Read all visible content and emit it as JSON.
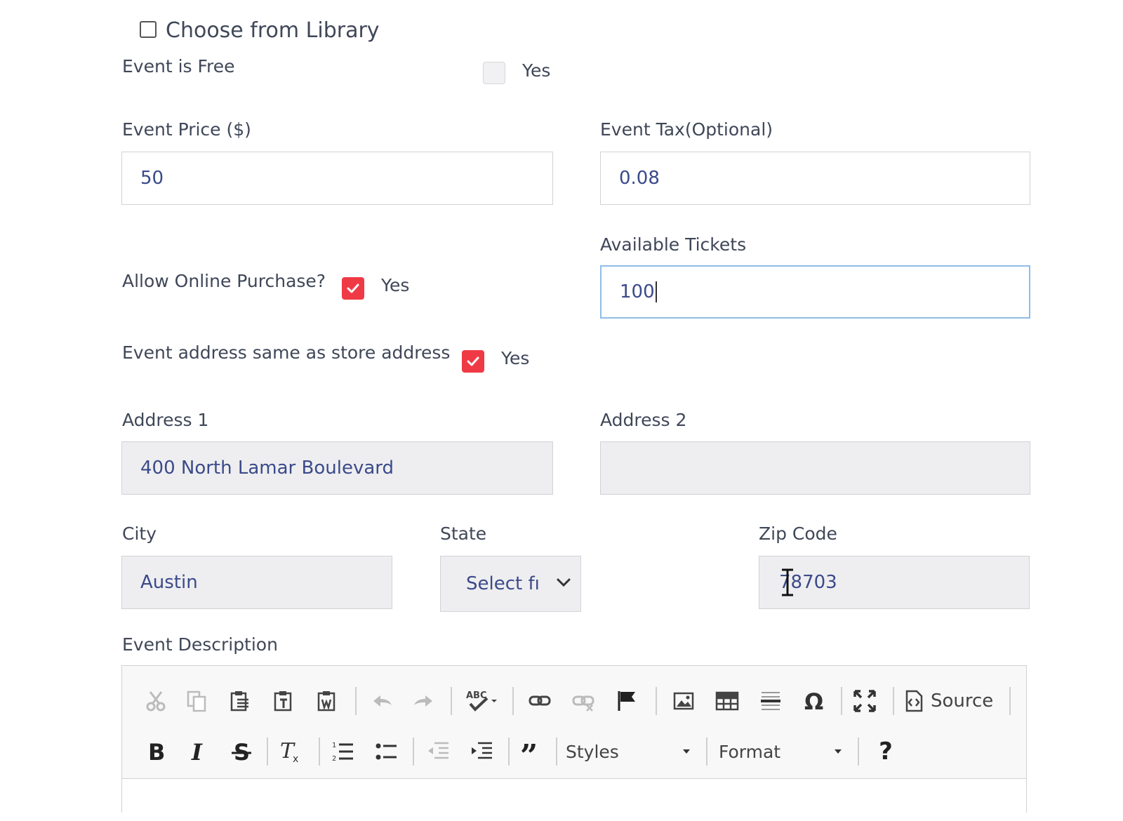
{
  "library": {
    "label": "Choose from Library",
    "checked": false
  },
  "event_free": {
    "label": "Event is Free",
    "option": "Yes",
    "checked": false
  },
  "price": {
    "label": "Event Price ($)",
    "value": "50"
  },
  "tax": {
    "label": "Event Tax(Optional)",
    "value": "0.08"
  },
  "online": {
    "label": "Allow Online Purchase?",
    "option": "Yes",
    "checked": true
  },
  "tickets": {
    "label": "Available Tickets",
    "value": "100"
  },
  "same_address": {
    "label": "Event address same as store address",
    "option": "Yes",
    "checked": true
  },
  "address1": {
    "label": "Address 1",
    "value": "400 North Lamar Boulevard"
  },
  "address2": {
    "label": "Address 2",
    "value": ""
  },
  "city": {
    "label": "City",
    "value": "Austin"
  },
  "state": {
    "label": "State",
    "value": "Select fı"
  },
  "zip": {
    "label": "Zip Code",
    "value": "78703"
  },
  "description": {
    "label": "Event Description",
    "toolbar": {
      "source_label": "Source",
      "styles_label": "Styles",
      "format_label": "Format",
      "help_label": "?"
    }
  },
  "colors": {
    "check_red": "#ef3a45",
    "text_blue": "#3b4a8a",
    "focus_border": "#8fbde6"
  }
}
